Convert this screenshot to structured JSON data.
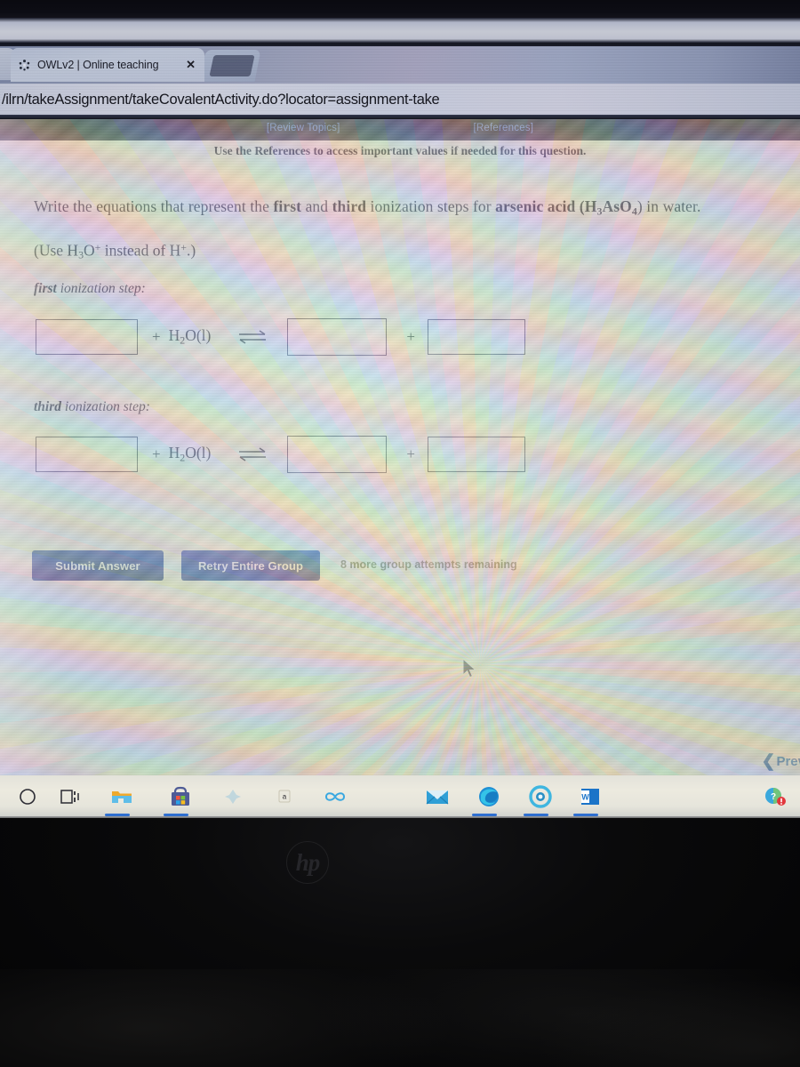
{
  "browser": {
    "tab": {
      "title": "OWLv2 | Online teaching",
      "close_label": "✕",
      "favicon_name": "owlv2-favicon"
    },
    "url": "/ilrn/takeAssignment/takeCovalentActivity.do?locator=assignment-take"
  },
  "page": {
    "top_links": [
      {
        "label": "[Review Topics]"
      },
      {
        "label": "[References]"
      }
    ],
    "reference_note": "Use the References to access important values if needed for this question.",
    "question": {
      "prompt_parts": {
        "p1": "Write the equations that represent the ",
        "b1": "first",
        "p2": " and ",
        "b2": "third",
        "p3": " ionization steps for ",
        "b3": "arsenic acid",
        "p4": " (H",
        "sub1": "3",
        "p5": "AsO",
        "sub2": "4",
        "p6": ") in water."
      },
      "use_note_parts": {
        "u1": "(Use H",
        "usub1": "3",
        "u2": "O",
        "usup1": "+",
        "u3": " instead of H",
        "usup2": "+",
        "u4": ".)"
      }
    },
    "steps": [
      {
        "label_bold": "first",
        "label_rest": " ionization step:",
        "reactant_box_value": "",
        "plus1": "+",
        "water": "H₂O(l)",
        "arrow_name": "equilibrium-arrow",
        "product_box1_value": "",
        "plus2": "+",
        "product_box2_value": ""
      },
      {
        "label_bold": "third",
        "label_rest": " ionization step:",
        "reactant_box_value": "",
        "plus1": "+",
        "water": "H₂O(l)",
        "arrow_name": "equilibrium-arrow",
        "product_box1_value": "",
        "plus2": "+",
        "product_box2_value": ""
      }
    ],
    "buttons": {
      "submit": "Submit Answer",
      "retry": "Retry Entire Group"
    },
    "attempts_text": "8 more group attempts remaining",
    "prev_button": {
      "chevron": "❮",
      "label": "Prev"
    }
  },
  "taskbar": {
    "items": [
      {
        "name": "cortana-search-icon",
        "label": "Search"
      },
      {
        "name": "task-view-icon",
        "label": "Task View"
      },
      {
        "name": "file-explorer-icon",
        "label": "File Explorer"
      },
      {
        "name": "microsoft-store-icon",
        "label": "Microsoft Store"
      },
      {
        "name": "photos-icon",
        "label": "Photos"
      },
      {
        "name": "amazon-icon",
        "label": "Amazon"
      },
      {
        "name": "infinity-app-icon",
        "label": "Connect"
      },
      {
        "name": "mail-icon",
        "label": "Mail"
      },
      {
        "name": "microsoft-edge-icon",
        "label": "Microsoft Edge"
      },
      {
        "name": "chromium-browser-icon",
        "label": "Browser"
      },
      {
        "name": "microsoft-word-icon",
        "label": "Word"
      }
    ],
    "tray": [
      {
        "name": "get-help-icon",
        "label": "Get Help"
      }
    ]
  },
  "device": {
    "brand_logo": "hp"
  },
  "colors": {
    "accent_blue": "#16328c",
    "link_blue": "#5c86d8",
    "tab_bar": "#9aa0ba",
    "taskbar": "#eceadf",
    "bezel": "#0a0a0b"
  }
}
